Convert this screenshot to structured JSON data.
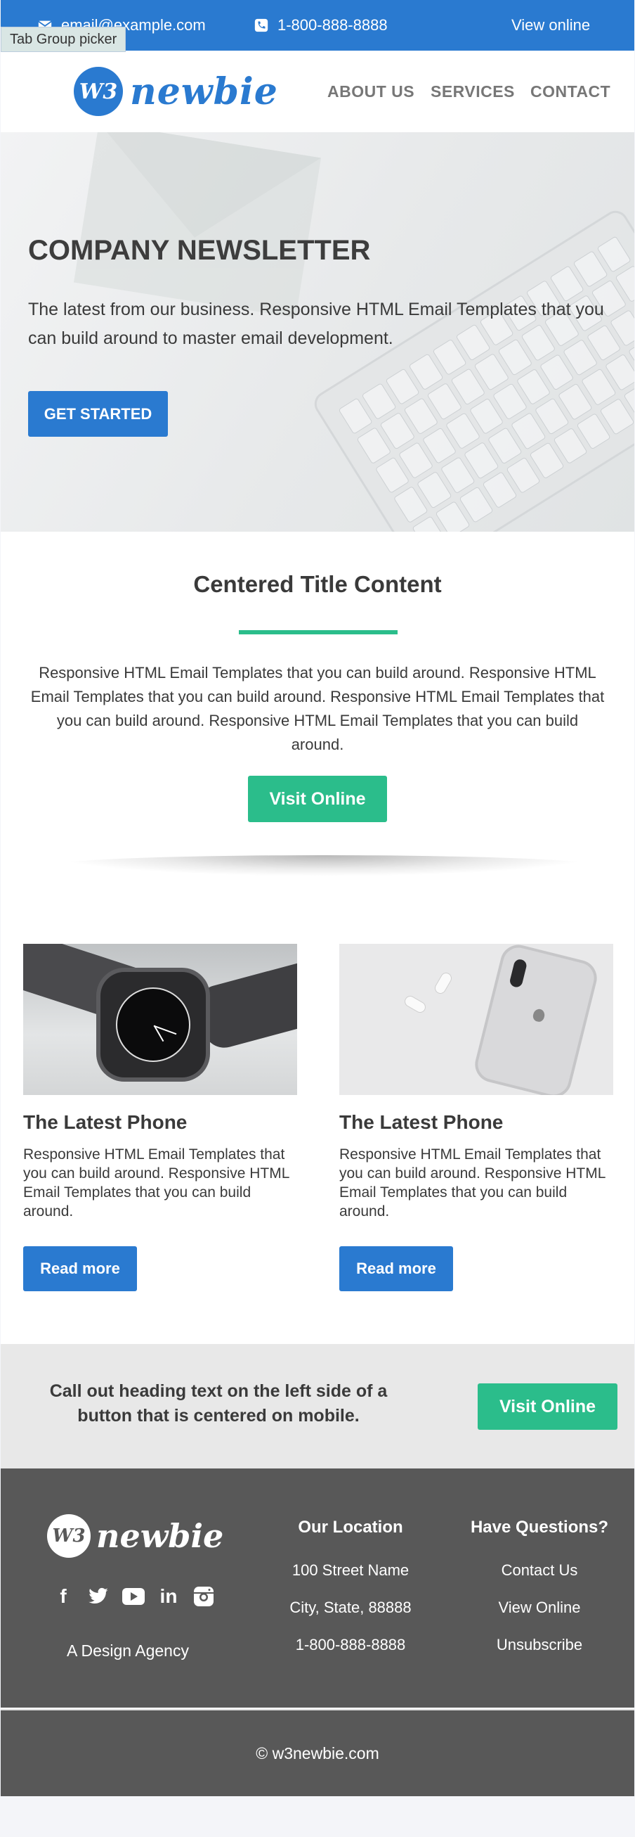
{
  "topbar": {
    "email": "email@example.com",
    "phone": "1-800-888-8888",
    "view_online": "View online",
    "tab_group_picker": "Tab Group picker"
  },
  "header": {
    "logo_mark": "W3",
    "logo_text": "newbie",
    "nav": [
      "ABOUT US",
      "SERVICES",
      "CONTACT"
    ]
  },
  "hero": {
    "title": "COMPANY NEWSLETTER",
    "text": "The latest from our business. Responsive HTML Email Templates that you can build around to master email development.",
    "button": "GET STARTED"
  },
  "centered": {
    "title": "Centered Title Content",
    "text": "Responsive HTML Email Templates that you can build around. Responsive HTML Email Templates that you can build around. Responsive HTML Email Templates that you can build around. Responsive HTML Email Templates that you can build around.",
    "button": "Visit Online"
  },
  "cards": [
    {
      "title": "The Latest Phone",
      "text": "Responsive HTML Email Templates that you can build around. Responsive HTML Email Templates that you can build around.",
      "button": "Read more"
    },
    {
      "title": "The Latest Phone",
      "text": "Responsive HTML Email Templates that you can build around. Responsive HTML Email Templates that you can build around.",
      "button": "Read more"
    }
  ],
  "callout": {
    "text": "Call out heading text on the left side of a button that is centered on mobile.",
    "button": "Visit Online"
  },
  "footer": {
    "logo_mark": "W3",
    "logo_text": "newbie",
    "tagline": "A Design Agency",
    "social_icons": [
      "facebook-icon",
      "twitter-icon",
      "youtube-icon",
      "linkedin-icon",
      "instagram-icon"
    ],
    "location": {
      "heading": "Our Location",
      "lines": [
        "100 Street Name",
        "City, State, 88888",
        "1-800-888-8888"
      ]
    },
    "questions": {
      "heading": "Have Questions?",
      "links": [
        "Contact Us",
        "View Online",
        "Unsubscribe"
      ]
    },
    "copyright": "© w3newbie.com"
  },
  "colors": {
    "primary_blue": "#2a7ad0",
    "accent_green": "#2bbd8b",
    "footer_gray": "#585858",
    "callout_gray": "#e8e8e8"
  }
}
